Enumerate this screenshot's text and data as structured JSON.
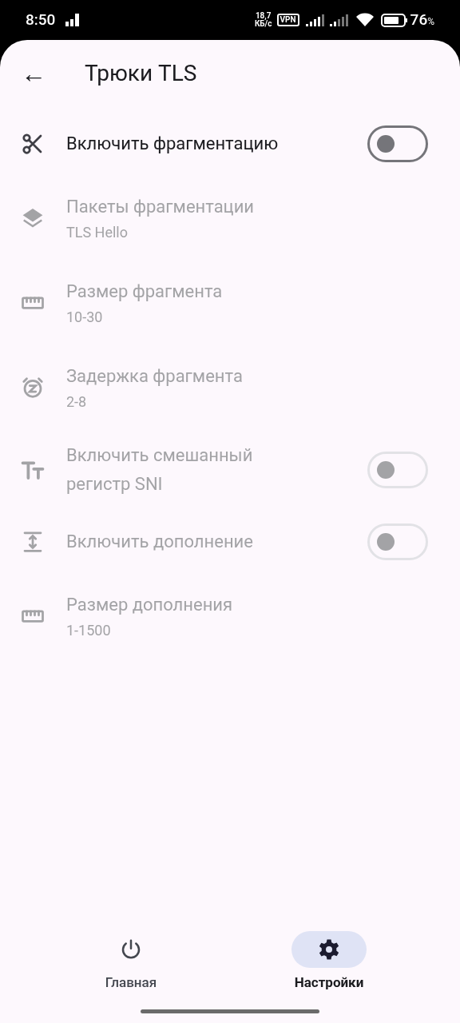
{
  "status_bar": {
    "time": "8:50",
    "speed_value": "18,7",
    "speed_unit": "КБ/с",
    "vpn": "VPN",
    "battery": "76",
    "battery_unit": "%"
  },
  "header": {
    "back": "←",
    "title": "Трюки TLS"
  },
  "settings": [
    {
      "kind": "switch",
      "title": "Включить фрагментацию",
      "disabled": false,
      "on": false
    },
    {
      "kind": "value",
      "title": "Пакеты фрагментации",
      "value": "TLS Hello",
      "disabled": true
    },
    {
      "kind": "value",
      "title": "Размер фрагмента",
      "value": "10-30",
      "disabled": true
    },
    {
      "kind": "value",
      "title": "Задержка фрагмента",
      "value": "2-8",
      "disabled": true
    },
    {
      "kind": "switch",
      "title": "Включить смешанный регистр SNI",
      "disabled": true,
      "on": false
    },
    {
      "kind": "switch",
      "title": "Включить дополнение",
      "disabled": true,
      "on": false
    },
    {
      "kind": "value",
      "title": "Размер дополнения",
      "value": "1-1500",
      "disabled": true
    }
  ],
  "nav": [
    {
      "label": "Главная",
      "selected": false
    },
    {
      "label": "Настройки",
      "selected": true
    }
  ]
}
